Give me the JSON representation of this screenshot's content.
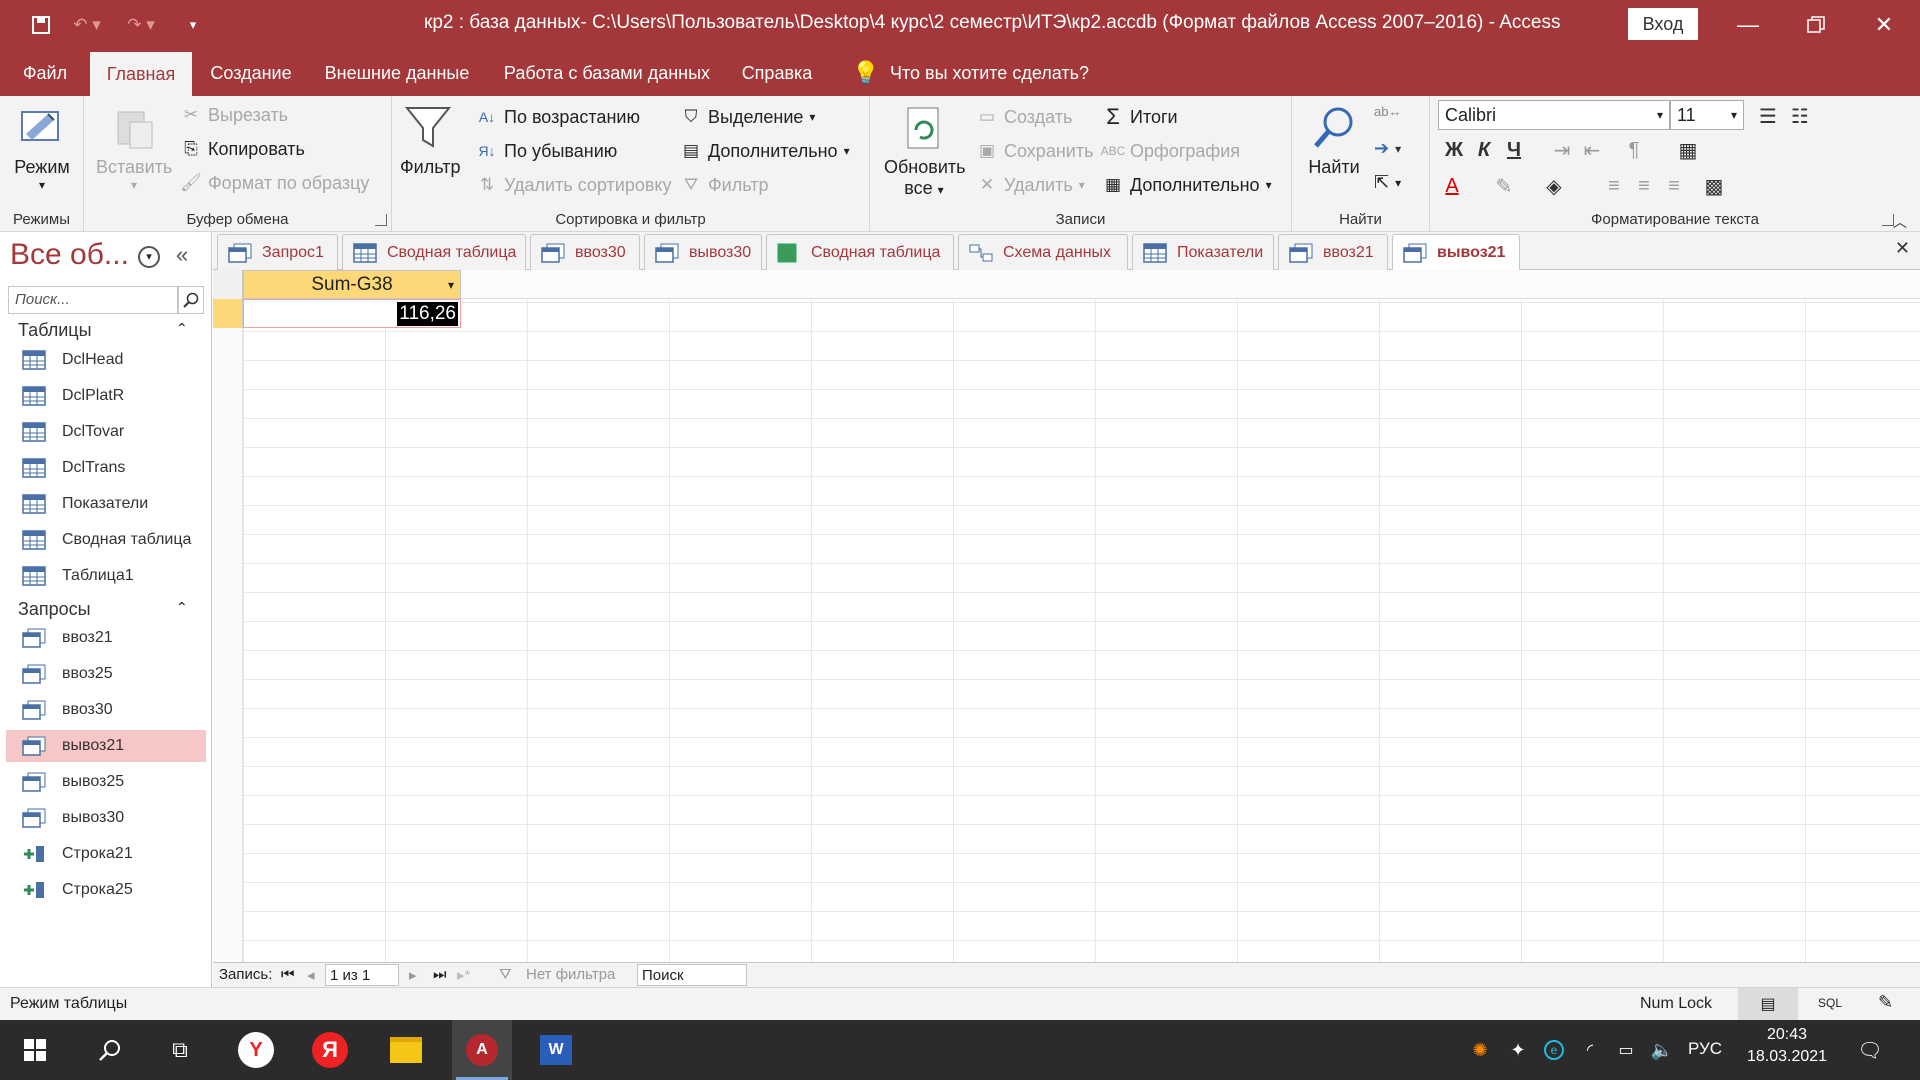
{
  "title_bar": {
    "title": "кр2 : база данных- C:\\Users\\Пользователь\\Desktop\\4 курс\\2 семестр\\ИТЭ\\кр2.accdb (Формат файлов Access 2007–2016)  -  Access",
    "sign_in": "Вход"
  },
  "ribbon_tabs": [
    "Файл",
    "Главная",
    "Создание",
    "Внешние данные",
    "Работа с базами данных",
    "Справка"
  ],
  "tell_me": "Что вы хотите сделать?",
  "ribbon": {
    "views": {
      "view_label": "Режим",
      "group": "Режимы"
    },
    "clipboard": {
      "paste": "Вставить",
      "cut": "Вырезать",
      "copy": "Копировать",
      "format_painter": "Формат по образцу",
      "group": "Буфер обмена"
    },
    "sort_filter": {
      "filter": "Фильтр",
      "ascending": "По возрастанию",
      "descending": "По убыванию",
      "remove_sort": "Удалить сортировку",
      "selection": "Выделение",
      "advanced": "Дополнительно",
      "toggle_filter": "Фильтр",
      "group": "Сортировка и фильтр"
    },
    "records": {
      "refresh_line1": "Обновить",
      "refresh_line2": "все",
      "new": "Создать",
      "save": "Сохранить",
      "delete": "Удалить",
      "totals": "Итоги",
      "spelling": "Орфография",
      "more": "Дополнительно",
      "group": "Записи"
    },
    "find": {
      "find": "Найти",
      "group": "Найти"
    },
    "text_formatting": {
      "font": "Calibri",
      "size": "11",
      "bold": "Ж",
      "italic": "К",
      "underline": "Ч",
      "group": "Форматирование текста"
    }
  },
  "nav_pane": {
    "title": "Все об...",
    "search_placeholder": "Поиск...",
    "sections": [
      {
        "header": "Таблицы",
        "items": [
          "DclHead",
          "DclPlatR",
          "DclTovar",
          "DclTrans",
          "Показатели",
          "Сводная таблица",
          "Таблица1"
        ]
      },
      {
        "header": "Запросы",
        "items": [
          "ввоз21",
          "ввоз25",
          "ввоз30",
          "вывоз21",
          "вывоз25",
          "вывоз30",
          "Строка21",
          "Строка25"
        ]
      }
    ],
    "selected": "вывоз21"
  },
  "doc_tabs": [
    "Запрос1",
    "Сводная таблица",
    "ввоз30",
    "вывоз30",
    "Сводная таблица",
    "Схема данных",
    "Показатели",
    "ввоз21",
    "вывоз21"
  ],
  "active_doc_tab": "вывоз21",
  "datasheet": {
    "columns": [
      "Sum-G38"
    ],
    "rows": [
      [
        "116,26"
      ]
    ]
  },
  "record_nav": {
    "label": "Запись:",
    "position": "1 из 1",
    "filter": "Нет фильтра",
    "search": "Поиск"
  },
  "status_bar": {
    "mode": "Режим таблицы",
    "numlock": "Num Lock",
    "sql": "SQL"
  },
  "taskbar": {
    "lang": "РУС",
    "time": "20:43",
    "date": "18.03.2021"
  },
  "colors": {
    "accent": "#a4373a",
    "header_fill": "#fdd878",
    "selected_nav": "#f7c6c7"
  }
}
